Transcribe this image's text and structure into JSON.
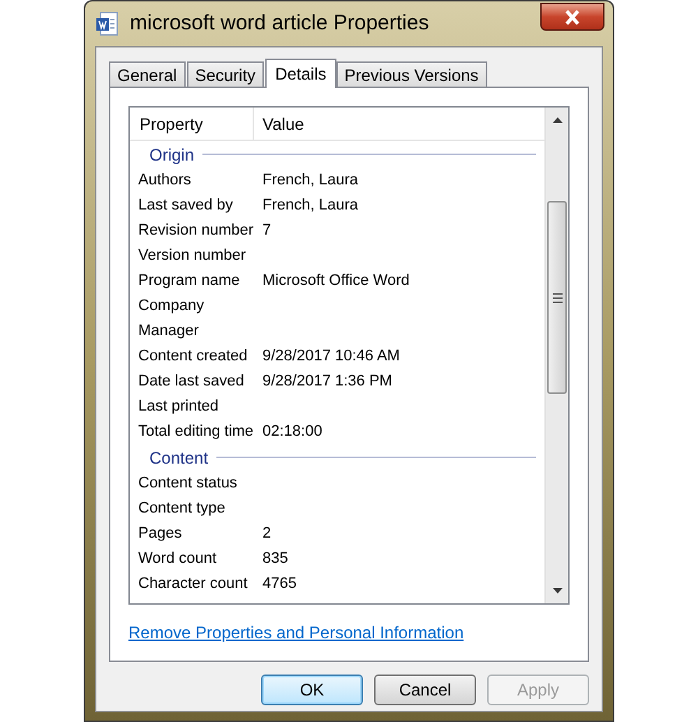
{
  "window": {
    "title": "microsoft word article Properties"
  },
  "tabs": [
    {
      "label": "General",
      "selected": false
    },
    {
      "label": "Security",
      "selected": false
    },
    {
      "label": "Details",
      "selected": true
    },
    {
      "label": "Previous Versions",
      "selected": false
    }
  ],
  "table": {
    "columns": [
      "Property",
      "Value"
    ],
    "groups": [
      {
        "title": "Origin",
        "rows": [
          {
            "property": "Authors",
            "value": "French, Laura"
          },
          {
            "property": "Last saved by",
            "value": "French, Laura"
          },
          {
            "property": "Revision number",
            "value": "7"
          },
          {
            "property": "Version number"
          },
          {
            "property": "Program name",
            "value": "Microsoft Office Word"
          },
          {
            "property": "Company"
          },
          {
            "property": "Manager"
          },
          {
            "property": "Content created",
            "value": "9/28/2017 10:46 AM"
          },
          {
            "property": "Date last saved",
            "value": "9/28/2017 1:36 PM"
          },
          {
            "property": "Last printed"
          },
          {
            "property": "Total editing time",
            "value": "02:18:00"
          }
        ]
      },
      {
        "title": "Content",
        "rows": [
          {
            "property": "Content status"
          },
          {
            "property": "Content type"
          },
          {
            "property": "Pages",
            "value": "2"
          },
          {
            "property": "Word count",
            "value": "835"
          },
          {
            "property": "Character count",
            "value": "4765"
          }
        ]
      }
    ]
  },
  "link": "Remove Properties and Personal Information",
  "buttons": [
    {
      "label": "OK",
      "default": true,
      "disabled": false
    },
    {
      "label": "Cancel",
      "default": false,
      "disabled": false
    },
    {
      "label": "Apply",
      "default": false,
      "disabled": true
    }
  ]
}
